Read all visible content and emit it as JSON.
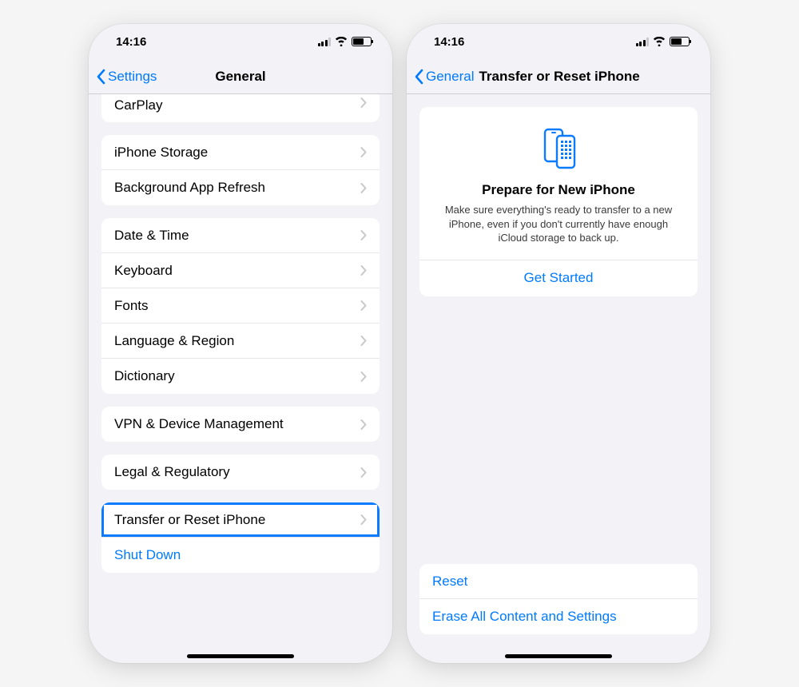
{
  "status": {
    "time": "14:16"
  },
  "left": {
    "back": "Settings",
    "title": "General",
    "rows": {
      "carplay": "CarPlay",
      "storage": "iPhone Storage",
      "bgrefresh": "Background App Refresh",
      "datetime": "Date & Time",
      "keyboard": "Keyboard",
      "fonts": "Fonts",
      "language": "Language & Region",
      "dictionary": "Dictionary",
      "vpn": "VPN & Device Management",
      "legal": "Legal & Regulatory",
      "transfer": "Transfer or Reset iPhone",
      "shutdown": "Shut Down"
    }
  },
  "right": {
    "back": "General",
    "title": "Transfer or Reset iPhone",
    "card": {
      "title": "Prepare for New iPhone",
      "desc": "Make sure everything's ready to transfer to a new iPhone, even if you don't currently have enough iCloud storage to back up.",
      "action": "Get Started"
    },
    "bottom": {
      "reset": "Reset",
      "erase": "Erase All Content and Settings"
    }
  }
}
